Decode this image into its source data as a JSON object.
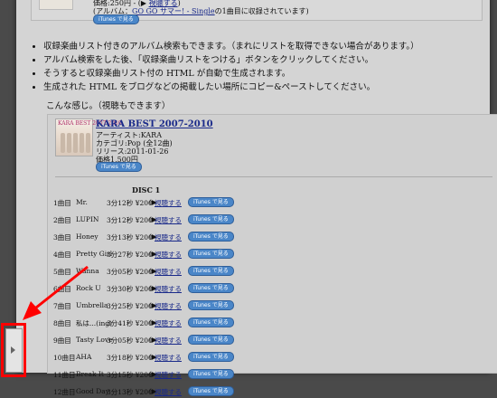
{
  "top_item": {
    "price_line_prefix": "価格:250円 - (",
    "listen_link": "視聴する",
    "price_line_suffix": ")",
    "album_line_prefix": "(アルバム：",
    "album_link": "GO GO サマー! - Single",
    "album_line_suffix": "の1曲目に収録されています)",
    "itunes_button": "iTunes で見る"
  },
  "bullets": [
    "収録楽曲リスト付きのアルバム検索もできます。（まれにリストを取得できない場合があります。）",
    "アルバム検索をした後、「収録楽曲リストをつける」ボタンをクリックしてください。",
    "そうすると収録楽曲リスト付の HTML が自動で生成されます。",
    "生成された HTML をブログなどの掲載したい場所にコピー&ペーストしてください。"
  ],
  "sample_label": "こんな感じ。（視聴もできます）",
  "album": {
    "cover_text": "KARA BEST 2007-2010",
    "title": "KARA BEST 2007-2010",
    "artist": "アーティスト:KARA",
    "category": "カテゴリ:Pop (全12曲)",
    "release": "リリース:2011-01-26",
    "price": "価格1,500円",
    "itunes_button": "iTunes で見る",
    "disc_label": "DISC 1"
  },
  "tracks": [
    {
      "no": "1曲目",
      "title": "Mr.",
      "time": "3分12秒 ¥200 -"
    },
    {
      "no": "2曲目",
      "title": "LUPIN",
      "time": "3分12秒 ¥200 -"
    },
    {
      "no": "3曲目",
      "title": "Honey",
      "time": "3分13秒 ¥200 -"
    },
    {
      "no": "4曲目",
      "title": "Pretty Girl",
      "time": "3分27秒 ¥200 -"
    },
    {
      "no": "5曲目",
      "title": "Wanna",
      "time": "3分05秒 ¥200 -"
    },
    {
      "no": "6曲目",
      "title": "Rock U",
      "time": "3分30秒 ¥200 -"
    },
    {
      "no": "7曲目",
      "title": "Umbrella",
      "time": "3分25秒 ¥200 -"
    },
    {
      "no": "8曲目",
      "title": "私は...(ing)",
      "time": "3分41秒 ¥200 -"
    },
    {
      "no": "9曲目",
      "title": "Tasty Love",
      "time": "3分05秒 ¥200 -"
    },
    {
      "no": "10曲目",
      "title": "AHA",
      "time": "3分18秒 ¥200 -"
    },
    {
      "no": "11曲目",
      "title": "Break It",
      "time": "3分15秒 ¥200 -"
    },
    {
      "no": "12曲目",
      "title": "Good Day",
      "time": "3分13秒 ¥200 -"
    }
  ],
  "track_listen_link": "視聴する",
  "track_itunes_button": "iTunes で見る",
  "colors": {
    "annotation": "#ff0000",
    "itunes_button": "#4a86c8",
    "link": "#1a2a8a"
  }
}
